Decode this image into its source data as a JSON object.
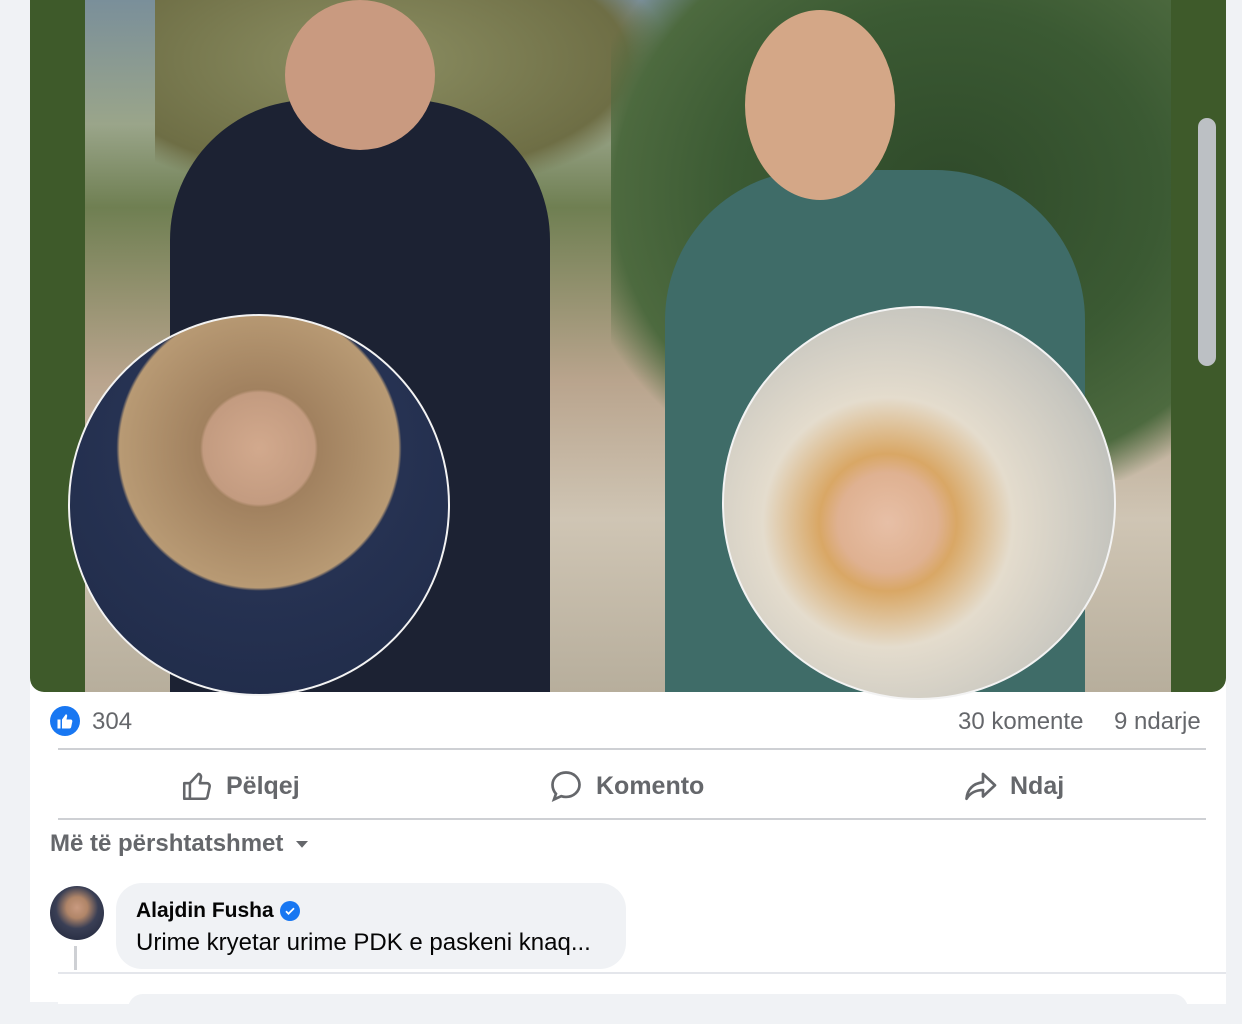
{
  "post": {
    "reactions_count": "304",
    "comments_count": "30 komente",
    "shares_count": "9 ndarje"
  },
  "actions": {
    "like_label": "Pëlqej",
    "comment_label": "Komento",
    "share_label": "Ndaj"
  },
  "comments": {
    "filter_label": "Më të përshtatshmet",
    "items": [
      {
        "author": "Alajdin Fusha",
        "text": "Urime kryetar urime PDK e paskeni knaq..."
      }
    ]
  },
  "colors": {
    "brand": "#1877f2",
    "photo_frame": "#3e5a2a",
    "muted_text": "#65676b"
  }
}
